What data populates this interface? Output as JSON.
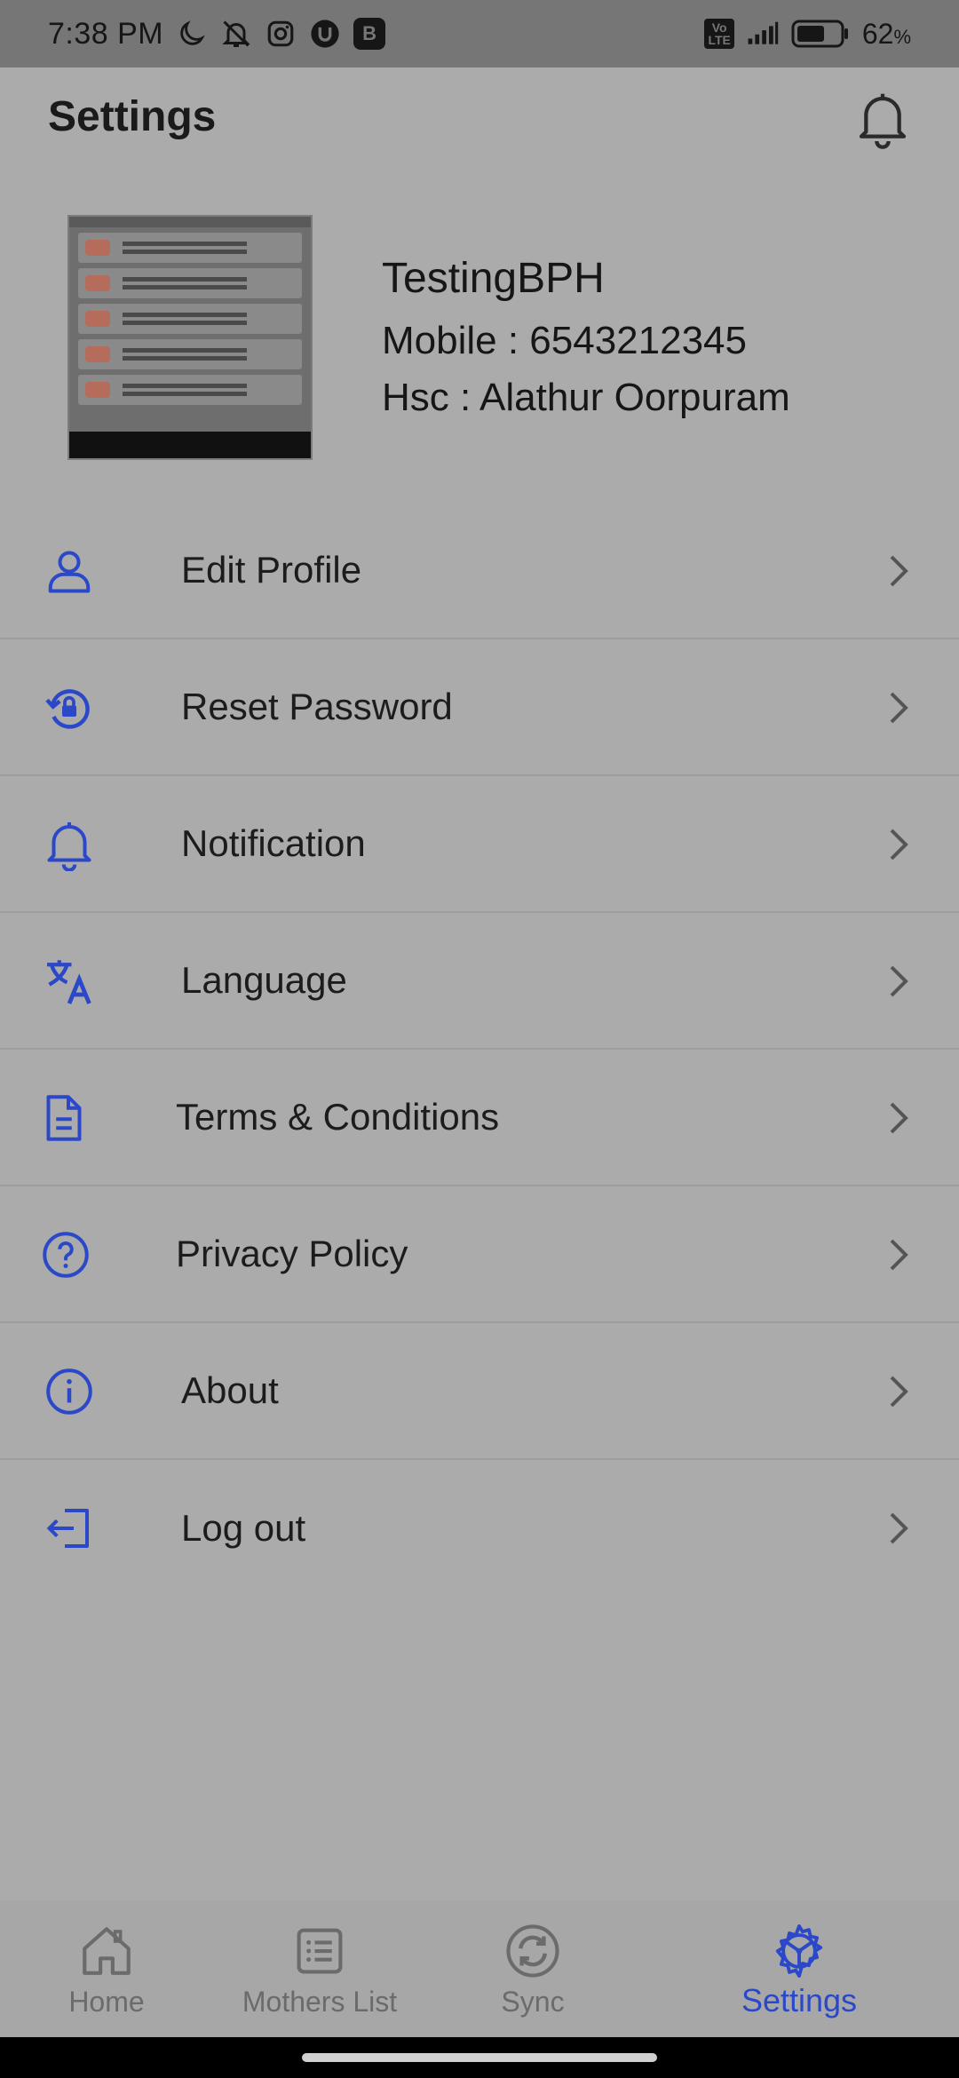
{
  "status_bar": {
    "time": "7:38 PM",
    "badge_letter": "B",
    "volte_top": "Vo",
    "volte_bottom": "LTE",
    "battery_percent": "62",
    "battery_suffix": "%"
  },
  "header": {
    "title": "Settings"
  },
  "profile": {
    "name": "TestingBPH",
    "mobile": "Mobile : 6543212345",
    "hsc": "Hsc : Alathur Oorpuram"
  },
  "menu": {
    "items": [
      {
        "label": "Edit Profile",
        "icon": "person-icon"
      },
      {
        "label": "Reset Password",
        "icon": "reset-lock-icon"
      },
      {
        "label": "Notification",
        "icon": "bell-icon"
      },
      {
        "label": "Language",
        "icon": "translate-icon"
      },
      {
        "label": "Terms & Conditions",
        "icon": "document-icon"
      },
      {
        "label": "Privacy Policy",
        "icon": "help-circle-icon"
      },
      {
        "label": "About",
        "icon": "info-circle-icon"
      },
      {
        "label": "Log out",
        "icon": "logout-icon"
      }
    ]
  },
  "bottom_nav": {
    "items": [
      {
        "label": "Home",
        "icon": "home-icon"
      },
      {
        "label": "Mothers List",
        "icon": "list-icon"
      },
      {
        "label": "Sync",
        "icon": "sync-icon"
      },
      {
        "label": "Settings",
        "icon": "settings-icon",
        "active": true
      }
    ]
  },
  "colors": {
    "accent": "#2a48c8",
    "background": "#ababab",
    "status_bar": "#767676",
    "inactive_nav": "#6b6b6b"
  }
}
